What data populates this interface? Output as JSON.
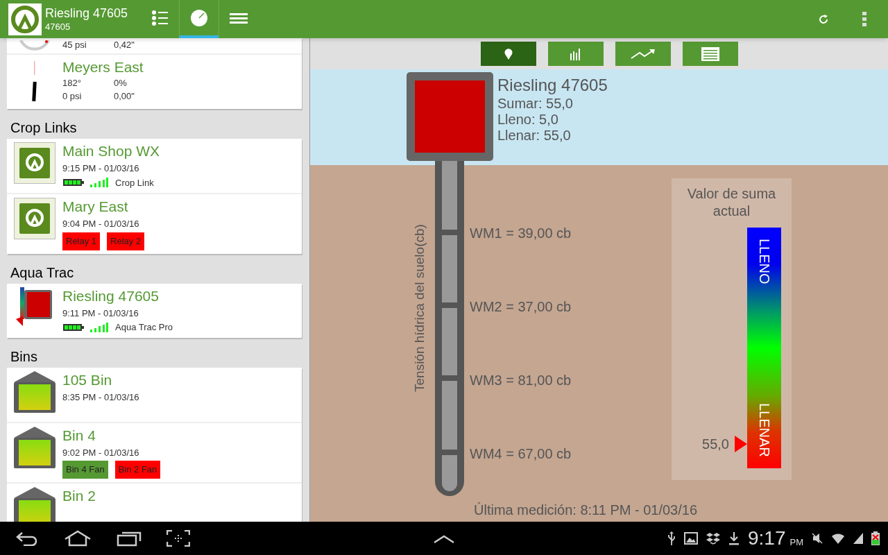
{
  "app_bar": {
    "title": "Riesling 47605",
    "subtitle": "47605",
    "tabs": [
      {
        "kind": "list",
        "selected": false
      },
      {
        "kind": "gauge",
        "selected": true
      },
      {
        "kind": "menu",
        "selected": false
      }
    ]
  },
  "sidebar": {
    "sections": [
      {
        "items": [
          {
            "kind": "pivot",
            "lines": [
              [
                "45 psi",
                "0,42\""
              ]
            ]
          },
          {
            "kind": "pivot",
            "name": "Meyers East",
            "lines": [
              [
                "182°",
                "0%"
              ],
              [
                "0 psi",
                "0,00\""
              ]
            ]
          }
        ]
      },
      {
        "title": "Crop Links",
        "items": [
          {
            "kind": "croplink",
            "name": "Main Shop WX",
            "time": "9:15 PM - 01/03/16",
            "device": "Crop Link"
          },
          {
            "kind": "croplink",
            "name": "Mary East",
            "time": "9:04 PM - 01/03/16",
            "tags": [
              {
                "label": "Relay 1",
                "color": "#ff0000"
              },
              {
                "label": "Relay 2",
                "color": "#ff0000"
              }
            ]
          }
        ]
      },
      {
        "title": "Aqua Trac",
        "items": [
          {
            "kind": "aquatrac",
            "name": "Riesling 47605",
            "time": "9:11 PM - 01/03/16",
            "device": "Aqua Trac Pro"
          }
        ]
      },
      {
        "title": "Bins",
        "items": [
          {
            "kind": "bin",
            "name": "105 Bin",
            "time": "8:35 PM - 01/03/16"
          },
          {
            "kind": "bin",
            "name": "Bin 4",
            "time": "9:02 PM - 01/03/16",
            "tags": [
              {
                "label": "Bin 4 Fan",
                "color": "#559933"
              },
              {
                "label": "Bin 2 Fan",
                "color": "#ff0000"
              }
            ]
          },
          {
            "kind": "bin",
            "name": "Bin 2"
          }
        ]
      }
    ]
  },
  "toolbar": [
    {
      "kind": "map",
      "selected": true
    },
    {
      "kind": "bars",
      "selected": false
    },
    {
      "kind": "trend",
      "selected": false
    },
    {
      "kind": "table",
      "selected": false
    }
  ],
  "station": {
    "title": "Riesling 47605",
    "lines": [
      "Sumar: 55,0",
      "Lleno: 5,0",
      "Llenar: 55,0"
    ]
  },
  "axis_label": "Tensión hídrica del suelo(cb)",
  "sensors": [
    "WM1 = 39,00 cb",
    "WM2 = 37,00 cb",
    "WM3 = 81,00 cb",
    "WM4 = 67,00 cb"
  ],
  "legend": {
    "title": "Valor de suma actual",
    "top_label": "LLENO",
    "bottom_label": "LLENAR",
    "marker": {
      "value": "55,0",
      "level": 0.1
    }
  },
  "last_reading": "Última medición: 8:11 PM - 01/03/16",
  "status_bar": {
    "time": "9:17",
    "ampm": "PM"
  }
}
